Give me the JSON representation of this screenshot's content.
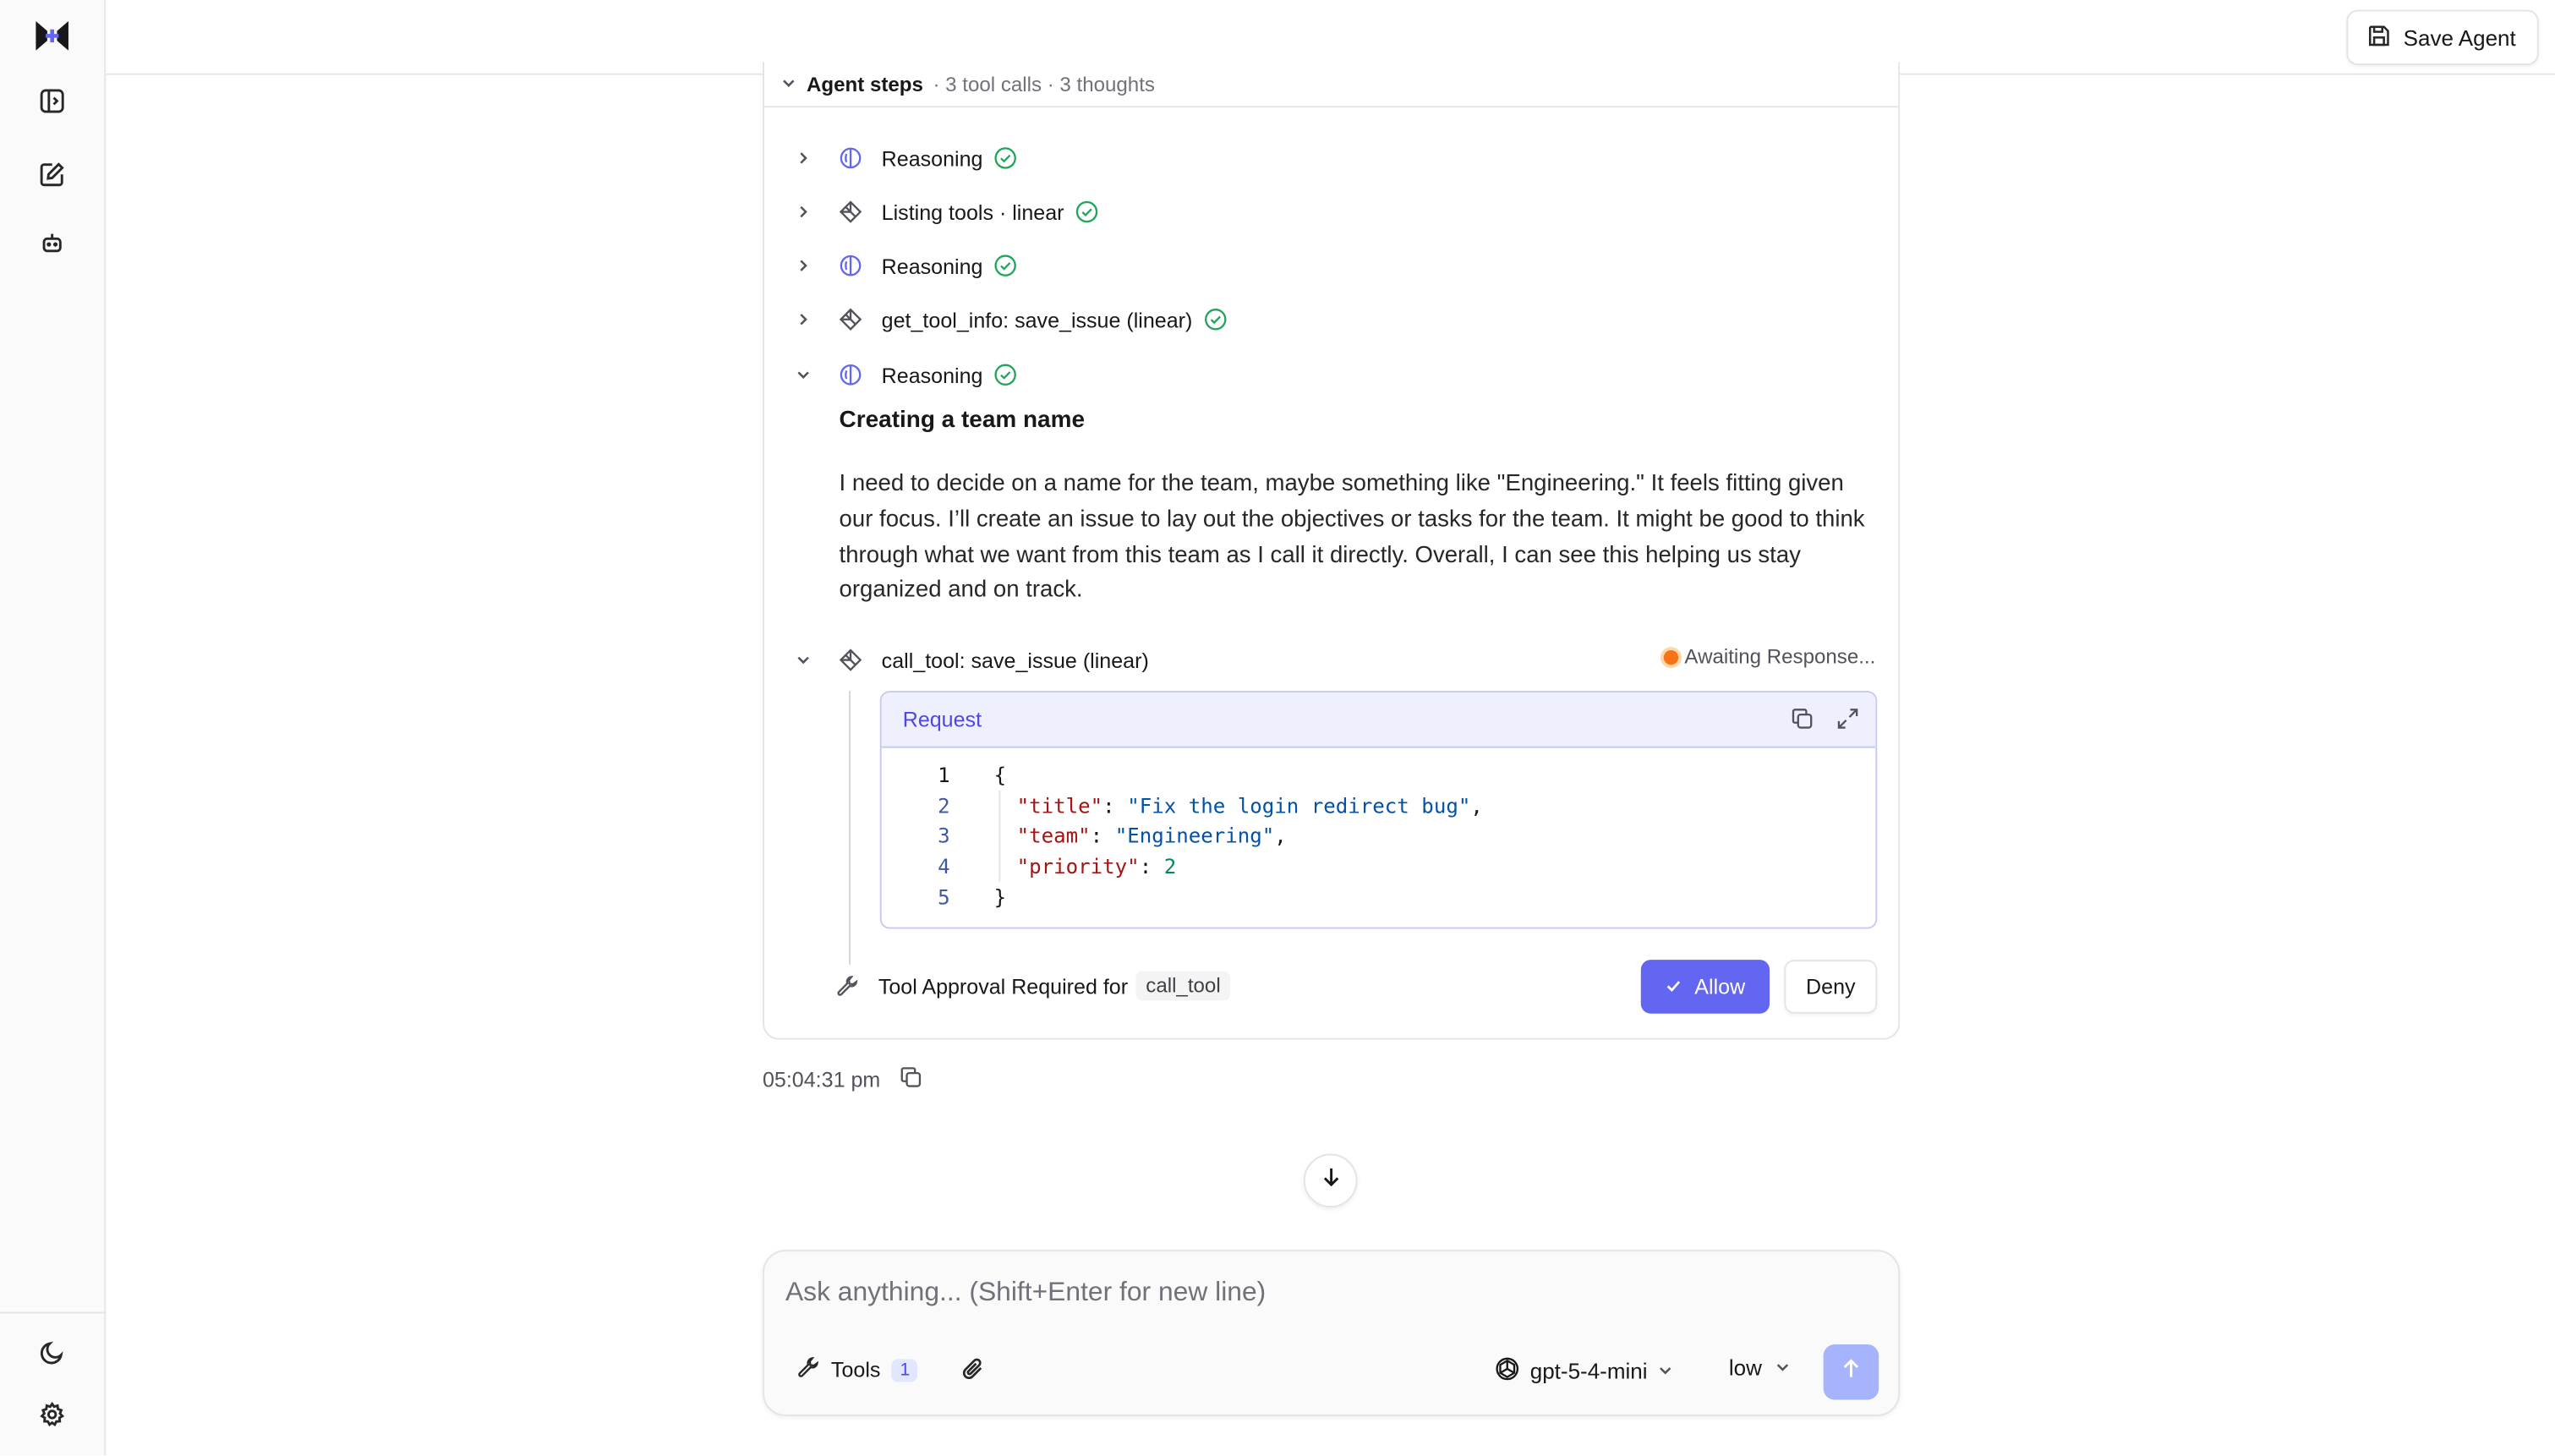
{
  "header": {
    "save_agent_label": "Save Agent"
  },
  "agent_steps": {
    "title": "Agent steps",
    "meta": "· 3 tool calls · 3 thoughts",
    "steps": [
      {
        "label": "Reasoning",
        "icon": "brain-icon",
        "status": "done",
        "expanded": false
      },
      {
        "label": "Listing tools · linear",
        "icon": "tool-icon",
        "status": "done",
        "expanded": false
      },
      {
        "label": "Reasoning",
        "icon": "brain-icon",
        "status": "done",
        "expanded": false
      },
      {
        "label": "get_tool_info: save_issue (linear)",
        "icon": "tool-icon",
        "status": "done",
        "expanded": false
      },
      {
        "label": "Reasoning",
        "icon": "brain-icon",
        "status": "done",
        "expanded": true
      },
      {
        "label": "call_tool: save_issue (linear)",
        "icon": "tool-icon",
        "status": "pending",
        "expanded": true
      }
    ],
    "thought_title": "Creating a team name",
    "thought_body": "I need to decide on a name for the team, maybe something like \"Engineering.\" It feels fitting given our focus. I’ll create an issue to lay out the objectives or tasks for the team. It might be good to think through what we want from this team as I call it directly. Overall, I can see this helping us stay organized and on track.",
    "awaiting_label": "Awaiting Response...",
    "request": {
      "label": "Request",
      "line_numbers": [
        "1",
        "2",
        "3",
        "4",
        "5"
      ],
      "open_brace": "{",
      "close_brace": "}",
      "fields": [
        {
          "key": "\"title\"",
          "value": "\"Fix the login redirect bug\""
        },
        {
          "key": "\"team\"",
          "value": "\"Engineering\""
        },
        {
          "key": "\"priority\"",
          "value": "2"
        }
      ]
    },
    "approval": {
      "text": "Tool Approval Required for",
      "tool_name": "call_tool",
      "allow_label": "Allow",
      "deny_label": "Deny"
    }
  },
  "message": {
    "timestamp": "05:04:31 pm"
  },
  "composer": {
    "placeholder": "Ask anything... (Shift+Enter for new line)",
    "tools_label": "Tools",
    "tools_count": "1",
    "model": "gpt-5-4-mini",
    "effort": "low"
  },
  "colors": {
    "accent": "#6366f1",
    "success": "#22a55a",
    "pending": "#f97316",
    "brain": "#6366f1"
  }
}
